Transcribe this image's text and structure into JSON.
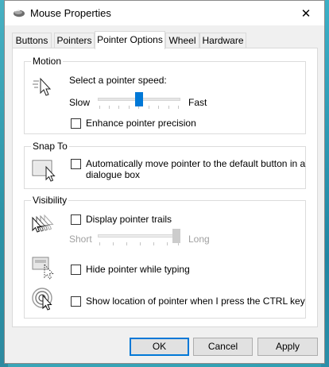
{
  "window": {
    "title": "Mouse Properties",
    "close_glyph": "✕"
  },
  "tabs": [
    {
      "label": "Buttons"
    },
    {
      "label": "Pointers"
    },
    {
      "label": "Pointer Options",
      "active": true
    },
    {
      "label": "Wheel"
    },
    {
      "label": "Hardware"
    }
  ],
  "motion": {
    "group_label": "Motion",
    "speed_label": "Select a pointer speed:",
    "slow_label": "Slow",
    "fast_label": "Fast",
    "speed_value": 0.5,
    "enhance_label": "Enhance pointer precision",
    "enhance_checked": false
  },
  "snap": {
    "group_label": "Snap To",
    "auto_move_label_line1": "Automatically move pointer to the default button in a",
    "auto_move_label_line2": "dialogue box",
    "auto_move_checked": false
  },
  "visibility": {
    "group_label": "Visibility",
    "trails_label": "Display pointer trails",
    "trails_checked": false,
    "short_label": "Short",
    "long_label": "Long",
    "trails_value": 1.0,
    "hide_label": "Hide pointer while typing",
    "hide_checked": false,
    "ctrl_label": "Show location of pointer when I press the CTRL key",
    "ctrl_checked": false
  },
  "buttons": {
    "ok": "OK",
    "cancel": "Cancel",
    "apply": "Apply"
  },
  "colors": {
    "accent": "#0078d7",
    "disabled_text": "#a0a0a0"
  }
}
